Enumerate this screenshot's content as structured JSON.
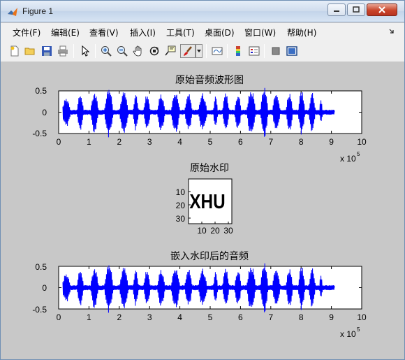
{
  "window": {
    "title": "Figure 1"
  },
  "menu": {
    "items": [
      "文件(F)",
      "编辑(E)",
      "查看(V)",
      "插入(I)",
      "工具(T)",
      "桌面(D)",
      "窗口(W)",
      "帮助(H)"
    ]
  },
  "toolbar": {
    "buttons": [
      "new-figure",
      "open-file",
      "save",
      "print",
      "pointer",
      "zoom-in",
      "zoom-out",
      "pan",
      "rotate-3d",
      "data-cursor",
      "brush",
      "link-plot",
      "insert-colorbar",
      "insert-legend",
      "hide-plot-tools",
      "show-plot-tools"
    ]
  },
  "plots": {
    "original_audio": {
      "title": "原始音频波形图",
      "yticks": [
        "0.5",
        "0",
        "-0.5"
      ],
      "xticks": [
        "0",
        "1",
        "2",
        "3",
        "4",
        "5",
        "6",
        "7",
        "8",
        "9",
        "10"
      ],
      "exponent_base": "x 10",
      "exponent_power": "5"
    },
    "watermark": {
      "title": "原始水印",
      "image_text": "XHU",
      "yticks": [
        "10",
        "20",
        "30"
      ],
      "xticks": [
        "10",
        "20",
        "30"
      ]
    },
    "watermarked_audio": {
      "title": "嵌入水印后的音频",
      "yticks": [
        "0.5",
        "0",
        "-0.5"
      ],
      "xticks": [
        "0",
        "1",
        "2",
        "3",
        "4",
        "5",
        "6",
        "7",
        "8",
        "9",
        "10"
      ],
      "exponent_base": "x 10",
      "exponent_power": "5"
    }
  },
  "colors": {
    "signal": "#0000ff",
    "axes_bg": "#ffffff",
    "figure_bg": "#c8c8c8"
  }
}
